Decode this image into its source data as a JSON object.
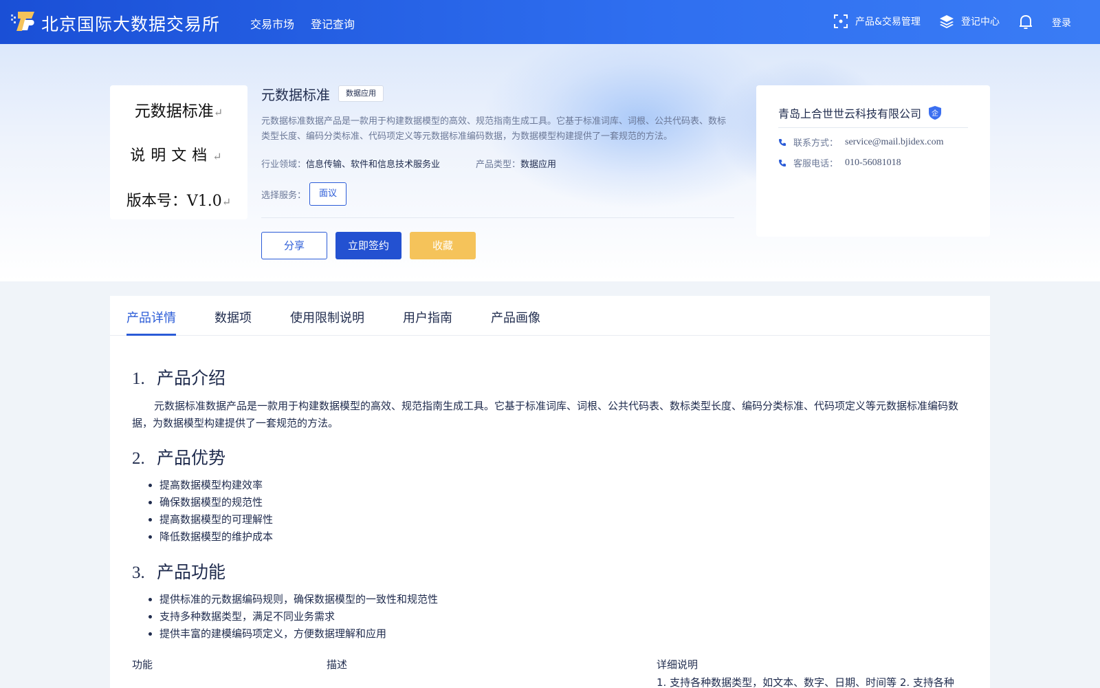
{
  "header": {
    "brand": "北京国际大数据交易所",
    "nav": [
      "交易市场",
      "登记查询"
    ],
    "right": {
      "product_mgmt": "产品&交易管理",
      "registry_center": "登记中心",
      "login": "登录"
    },
    "icons": [
      "logo-icon",
      "scan-icon",
      "layers-icon",
      "bell-icon"
    ]
  },
  "doc_preview": {
    "line1": "元数据标准",
    "line2": "说明文档",
    "line3": "版本号：V1.0",
    "return_mark": "↵"
  },
  "product": {
    "title": "元数据标准",
    "tag": "数据应用",
    "description": "元数据标准数据产品是一款用于构建数据模型的高效、规范指南生成工具。它基于标准词库、词根、公共代码表、数标类型长度、编码分类标准、代码项定义等元数据标准编码数据，为数据模型构建提供了一套规范的方法。",
    "industry_label": "行业领域：",
    "industry_value": "信息传输、软件和信息技术服务业",
    "type_label": "产品类型：",
    "type_value": "数据应用",
    "service_label": "选择服务：",
    "service_option": "面议",
    "buttons": {
      "share": "分享",
      "sign": "立即签约",
      "favorite": "收藏"
    }
  },
  "vendor": {
    "name": "青岛上合世世云科技有限公司",
    "badge": "企",
    "contact_label": "联系方式：",
    "contact_value": "service@mail.bjidex.com",
    "phone_label": "客服电话：",
    "phone_value": "010-56081018"
  },
  "tabs": [
    "产品详情",
    "数据项",
    "使用限制说明",
    "用户指南",
    "产品画像"
  ],
  "active_tab": 0,
  "content": {
    "sections": [
      {
        "num": "1.",
        "title": "产品介绍"
      },
      {
        "num": "2.",
        "title": "产品优势"
      },
      {
        "num": "3.",
        "title": "产品功能"
      }
    ],
    "intro": "元数据标准数据产品是一款用于构建数据模型的高效、规范指南生成工具。它基于标准词库、词根、公共代码表、数标类型长度、编码分类标准、代码项定义等元数据标准编码数据，为数据模型构建提供了一套规范的方法。",
    "advantages": [
      "提高数据模型构建效率",
      "确保数据模型的规范性",
      "提高数据模型的可理解性",
      "降低数据模型的维护成本"
    ],
    "features": [
      "提供标准的元数据编码规则，确保数据模型的一致性和规范性",
      "支持多种数据类型，满足不同业务需求",
      "提供丰富的建模编码项定义，方便数据理解和应用"
    ],
    "table": {
      "headers": [
        "功能",
        "描述",
        "详细说明"
      ],
      "detail_preview": "1. 支持各种数据类型，如文本、数字、日期、时间等 2. 支持各种"
    }
  },
  "colors": {
    "primary": "#2a5bd7",
    "header_start": "#1a4fd6",
    "favorite": "#f5c35a",
    "text_dark": "#1f2b4d",
    "text_muted": "#6b7897"
  }
}
